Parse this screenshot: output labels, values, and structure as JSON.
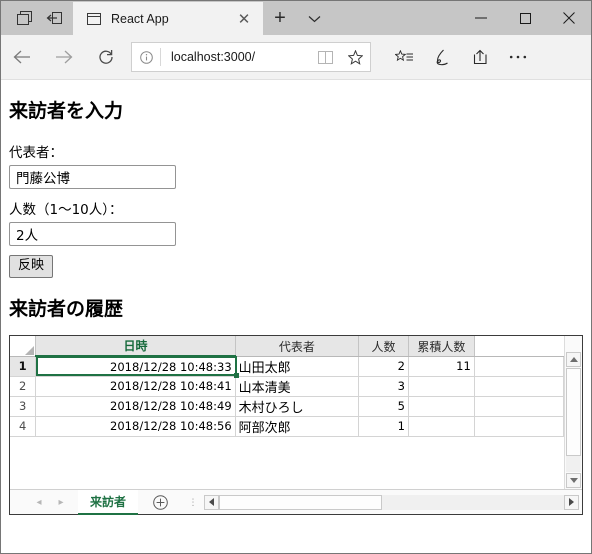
{
  "browser": {
    "tab_aside_icon": "set-tabs-aside-icon",
    "tabs_restore_icon": "restore-tabs-icon",
    "tab": {
      "favicon": "window-icon",
      "title": "React App",
      "close_label": "✕"
    },
    "new_tab_label": "+",
    "tab_menu_label": "⌄",
    "window_controls": {
      "minimize": "─",
      "maximize": "☐",
      "close": "✕"
    },
    "nav": {
      "back": "←",
      "forward": "→",
      "refresh": "⟳"
    },
    "address": {
      "info_icon": "info-icon",
      "url": "localhost:3000/",
      "reading_view_icon": "reading-view-icon",
      "favorite_icon": "star-icon"
    },
    "toolbar": {
      "favorites_hub": "favorites-hub-icon",
      "web_note": "web-note-pen-icon",
      "share": "share-icon",
      "settings": "more-settings-icon"
    }
  },
  "page": {
    "input_section": {
      "heading": "来訪者を入力",
      "name_label": "代表者：",
      "name_value": "門藤公博",
      "name_placeholder": "",
      "count_label": "人数（1〜10人）：",
      "count_value": "2人",
      "count_placeholder": "",
      "submit_label": "反映"
    },
    "history_section": {
      "heading": "来訪者の履歴"
    }
  },
  "spreadsheet": {
    "columns": [
      {
        "label": "日時",
        "active": true
      },
      {
        "label": "代表者",
        "active": false
      },
      {
        "label": "人数",
        "active": false
      },
      {
        "label": "累積人数",
        "active": false
      }
    ],
    "rows": [
      {
        "num": "1",
        "date": "2018/12/28 10:48:33",
        "name": "山田太郎",
        "count": "2",
        "cumulative": "11"
      },
      {
        "num": "2",
        "date": "2018/12/28 10:48:41",
        "name": "山本清美",
        "count": "3",
        "cumulative": ""
      },
      {
        "num": "3",
        "date": "2018/12/28 10:48:49",
        "name": "木村ひろし",
        "count": "5",
        "cumulative": ""
      },
      {
        "num": "4",
        "date": "2018/12/28 10:48:56",
        "name": "阿部次郎",
        "count": "1",
        "cumulative": ""
      }
    ],
    "selected_cell": {
      "row": "1",
      "column": "日時"
    },
    "sheet_tabs": [
      {
        "label": "来訪者",
        "active": true
      }
    ],
    "add_sheet_label": "⊕",
    "nav_prev": "◂",
    "nav_next": "▸",
    "accent_color": "#1f7244",
    "scroll": {
      "v_up": "▲",
      "v_down": "▼",
      "h_left": "◀",
      "h_right": "▶"
    }
  }
}
